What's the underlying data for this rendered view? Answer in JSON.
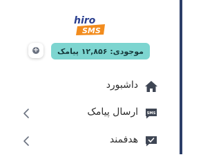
{
  "logo": {
    "top_text": "hiro",
    "bottom_text": "SMS"
  },
  "balance": {
    "add_icon": "plus-circle-icon",
    "text": "موجودی: ۱۲,۸۵۶ پیامک"
  },
  "menu": [
    {
      "label": "داشبورد",
      "icon": "home-icon",
      "has_chevron": false
    },
    {
      "label": "ارسال پیامک",
      "icon": "sms-icon",
      "has_chevron": true
    },
    {
      "label": "هدفمند",
      "icon": "message-check-icon",
      "has_chevron": true
    }
  ],
  "colors": {
    "accent": "#7dd5d0",
    "sidebar_border": "#2c3e68",
    "logo_orange": "#f28c1e",
    "logo_blue": "#2a3f8f",
    "icon_dark": "#3f4654"
  }
}
